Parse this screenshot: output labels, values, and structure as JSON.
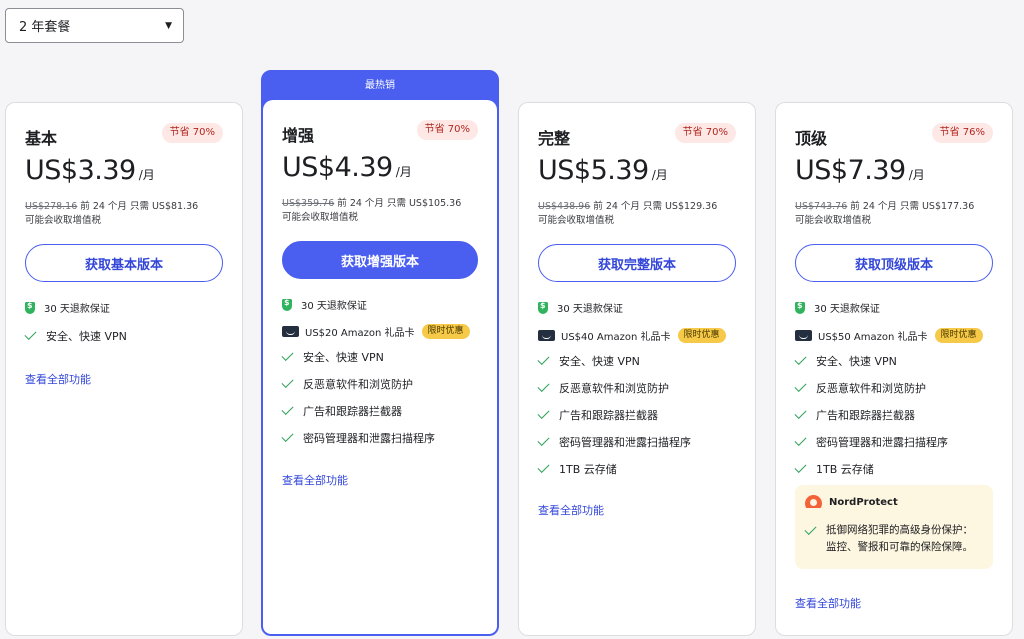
{
  "plan_selector": {
    "value": "2 年套餐"
  },
  "featured_banner": "最热销",
  "cards": [
    {
      "name": "基本",
      "save": "节省 70%",
      "price": "US$3.39",
      "per": "/月",
      "old_price": "US$278.16",
      "billing_rest": " 前 24 个月 只需 US$81.36",
      "tax": "可能会收取增值税",
      "cta": "获取基本版本",
      "guarantee": "30 天退款保证",
      "features": [
        "安全、快速 VPN"
      ],
      "see_all": "查看全部功能"
    },
    {
      "name": "增强",
      "save": "节省 70%",
      "price": "US$4.39",
      "per": "/月",
      "old_price": "US$359.76",
      "billing_rest": " 前 24 个月 只需 US$105.36",
      "tax": "可能会收取增值税",
      "cta": "获取增强版本",
      "guarantee": "30 天退款保证",
      "gift": "US$20 Amazon 礼品卡",
      "gift_badge": "限时优惠",
      "features": [
        "安全、快速 VPN",
        "反恶意软件和浏览防护",
        "广告和跟踪器拦截器",
        "密码管理器和泄露扫描程序"
      ],
      "see_all": "查看全部功能"
    },
    {
      "name": "完整",
      "save": "节省 70%",
      "price": "US$5.39",
      "per": "/月",
      "old_price": "US$438.96",
      "billing_rest": " 前 24 个月 只需 US$129.36",
      "tax": "可能会收取增值税",
      "cta": "获取完整版本",
      "guarantee": "30 天退款保证",
      "gift": "US$40 Amazon 礼品卡",
      "gift_badge": "限时优惠",
      "features": [
        "安全、快速 VPN",
        "反恶意软件和浏览防护",
        "广告和跟踪器拦截器",
        "密码管理器和泄露扫描程序",
        "1TB 云存储"
      ],
      "see_all": "查看全部功能"
    },
    {
      "name": "顶级",
      "save": "节省 76%",
      "price": "US$7.39",
      "per": "/月",
      "old_price": "US$743.76",
      "billing_rest": " 前 24 个月 只需 US$177.36",
      "tax": "可能会收取增值税",
      "cta": "获取顶级版本",
      "guarantee": "30 天退款保证",
      "gift": "US$50 Amazon 礼品卡",
      "gift_badge": "限时优惠",
      "features": [
        "安全、快速 VPN",
        "反恶意软件和浏览防护",
        "广告和跟踪器拦截器",
        "密码管理器和泄露扫描程序",
        "1TB 云存储"
      ],
      "protect_title": "NordProtect",
      "protect_text": "抵御网络犯罪的高级身份保护：监控、警报和可靠的保险保障。",
      "see_all": "查看全部功能"
    }
  ],
  "colors": {
    "accent": "#4a5ef0",
    "save_badge_bg": "#fde8e6",
    "limited_badge": "#f7c948",
    "check": "#2fa35a"
  }
}
